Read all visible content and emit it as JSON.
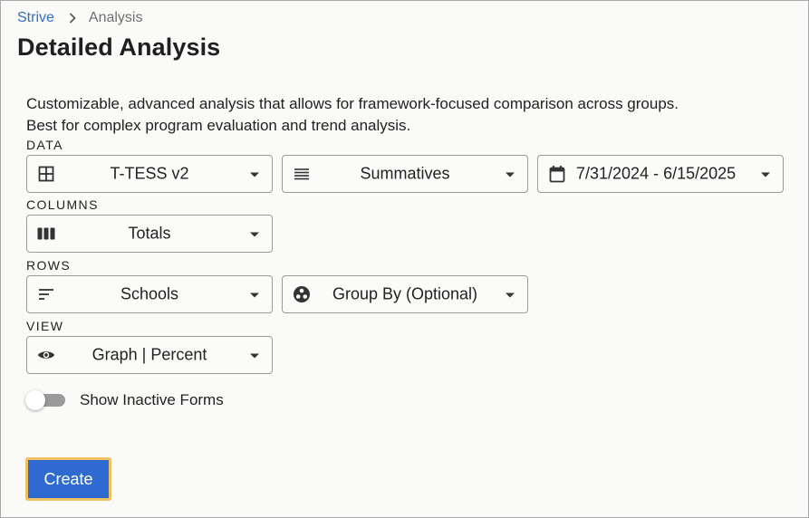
{
  "breadcrumb": {
    "root": "Strive",
    "current": "Analysis"
  },
  "page": {
    "title": "Detailed Analysis",
    "description_line1": "Customizable, advanced analysis that allows for framework-focused comparison across groups.",
    "description_line2": "Best for complex program evaluation and trend analysis."
  },
  "sections": {
    "data": "DATA",
    "columns": "COLUMNS",
    "rows": "ROWS",
    "view": "VIEW"
  },
  "data_selects": {
    "framework": {
      "value": "T-TESS v2",
      "icon": "grid-icon"
    },
    "form_type": {
      "value": "Summatives",
      "icon": "list-icon"
    },
    "date_range": {
      "value": "7/31/2024 - 6/15/2025",
      "icon": "calendar-icon"
    }
  },
  "columns_select": {
    "value": "Totals",
    "icon": "columns-icon"
  },
  "rows_selects": {
    "rows": {
      "value": "Schools",
      "icon": "sort-lines-icon"
    },
    "group_by": {
      "value": "Group By (Optional)",
      "icon": "workspaces-icon"
    }
  },
  "view_select": {
    "value": "Graph | Percent",
    "icon": "eye-icon"
  },
  "toggle": {
    "label": "Show Inactive Forms",
    "checked": false
  },
  "create_button": {
    "label": "Create"
  },
  "colors": {
    "link": "#2f6fc6",
    "primary_button": "#2f6ad0",
    "focus_ring": "#f0c060"
  }
}
